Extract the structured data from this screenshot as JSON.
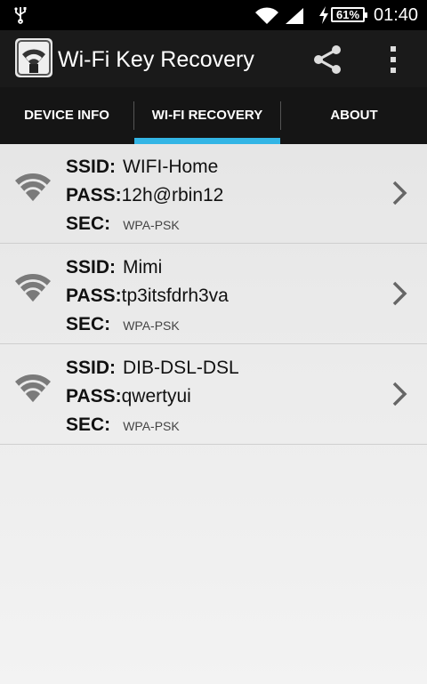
{
  "status_bar": {
    "time": "01:40",
    "battery": "61%",
    "icons": [
      "usb-icon",
      "wifi-icon",
      "signal-icon",
      "charging-icon",
      "battery-icon"
    ]
  },
  "action_bar": {
    "title": "Wi-Fi Key Recovery",
    "icons": [
      "app-logo-icon",
      "share-icon",
      "overflow-menu-icon"
    ]
  },
  "tabs": [
    {
      "label": "DEVICE INFO",
      "selected": false
    },
    {
      "label": "WI-FI RECOVERY",
      "selected": true
    },
    {
      "label": "ABOUT",
      "selected": false
    }
  ],
  "labels": {
    "ssid": "SSID:",
    "pass": "PASS:",
    "sec": "SEC:"
  },
  "networks": [
    {
      "ssid": "WIFI-Home",
      "pass": "12h@rbin12",
      "sec": "WPA-PSK"
    },
    {
      "ssid": "Mimi",
      "pass": "tp3itsfdrh3va",
      "sec": "WPA-PSK"
    },
    {
      "ssid": "DIB-DSL-DSL",
      "pass": "qwertyui",
      "sec": "WPA-PSK"
    }
  ],
  "colors": {
    "accent": "#33b5e5",
    "action_bar": "#1a1a1a",
    "tab_bar": "#151515",
    "wifi_icon": "#7a7a7a"
  }
}
